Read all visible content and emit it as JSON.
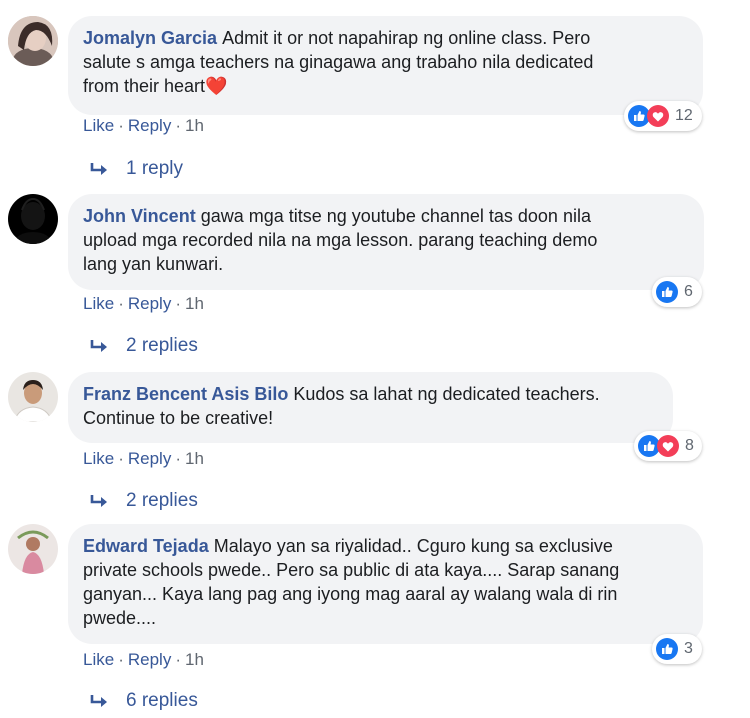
{
  "comments": [
    {
      "author": "Jomalyn Garcia",
      "line1": "Admit it or not napahirap ng online class. Pero",
      "line2": "salute s amga teachers na ginagawa ang trabaho nila dedicated",
      "line3": "from their heart",
      "emoji_icon": "heart-emoji-icon",
      "like": "Like",
      "reply": "Reply",
      "time": "1h",
      "reaction_icons": [
        "like-icon",
        "love-icon"
      ],
      "reaction_count": "12",
      "replies": "1 reply"
    },
    {
      "author": "John Vincent",
      "line1": "gawa mga titse ng youtube channel tas doon nila",
      "line2": "upload mga recorded nila na mga lesson. parang teaching demo",
      "line3": "lang yan kunwari.",
      "like": "Like",
      "reply": "Reply",
      "time": "1h",
      "reaction_icons": [
        "like-icon"
      ],
      "reaction_count": "6",
      "replies": "2 replies"
    },
    {
      "author": "Franz Bencent Asis Bilo",
      "line1": "Kudos sa lahat ng dedicated teachers.",
      "line2": "Continue to be creative!",
      "like": "Like",
      "reply": "Reply",
      "time": "1h",
      "reaction_icons": [
        "like-icon",
        "love-icon"
      ],
      "reaction_count": "8",
      "replies": "2 replies"
    },
    {
      "author": "Edward Tejada",
      "line1": "Malayo yan sa riyalidad.. Cguro kung sa exclusive",
      "line2": "private schools pwede.. Pero sa public di ata kaya.... Sarap sanang",
      "line3": "ganyan... Kaya lang pag ang iyong mag aaral ay walang wala di rin",
      "line4": "pwede....",
      "like": "Like",
      "reply": "Reply",
      "time": "1h",
      "reaction_icons": [
        "like-icon"
      ],
      "reaction_count": "3",
      "replies": "6 replies"
    }
  ],
  "colors": {
    "link": "#385898",
    "bubble": "#f2f3f5",
    "like_blue": "#1877f2",
    "love_red": "#f33e58",
    "meta_gray": "#606770"
  }
}
